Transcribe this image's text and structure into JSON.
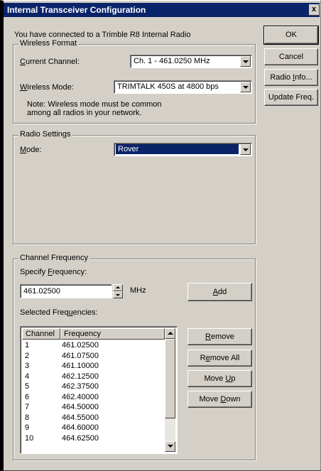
{
  "window": {
    "title": "Internal Transceiver Configuration",
    "close_glyph": "x"
  },
  "intro_text": "You have connected to a Trimble R8 Internal Radio",
  "wireless_format": {
    "legend": "Wireless Format",
    "channel_label": "Current Channel:",
    "channel_value": "Ch.  1 - 461.0250 MHz",
    "mode_label": "Wireless Mode:",
    "mode_value": "TRIMTALK 450S at 4800 bps",
    "note_line1": "Note: Wireless mode must be common",
    "note_line2": "among all radios in your network."
  },
  "radio_settings": {
    "legend": "Radio Settings",
    "mode_label": "Mode:",
    "mode_value": "Rover"
  },
  "channel_frequency": {
    "legend": "Channel Frequency",
    "specify_label": "Specify Frequency:",
    "frequency_value": "461.02500",
    "unit": "MHz",
    "add_label": "Add",
    "selected_label": "Selected Frequencies:",
    "columns": [
      "Channel",
      "Frequency"
    ],
    "rows": [
      [
        "1",
        "461.02500"
      ],
      [
        "2",
        "461.07500"
      ],
      [
        "3",
        "461.10000"
      ],
      [
        "4",
        "462.12500"
      ],
      [
        "5",
        "462.37500"
      ],
      [
        "6",
        "462.40000"
      ],
      [
        "7",
        "464.50000"
      ],
      [
        "8",
        "464.55000"
      ],
      [
        "9",
        "464.60000"
      ],
      [
        "10",
        "464.62500"
      ]
    ],
    "remove_label": "Remove",
    "remove_all_label": "Remove All",
    "move_up_label": "Move Up",
    "move_down_label": "Move Down"
  },
  "side_buttons": {
    "ok": "OK",
    "cancel": "Cancel",
    "radio_info": "Radio Info...",
    "update_freq": "Update Freq."
  },
  "colors": {
    "titlebar": "#0a246a",
    "face": "#d4d0c8",
    "selection": "#0a246a"
  }
}
